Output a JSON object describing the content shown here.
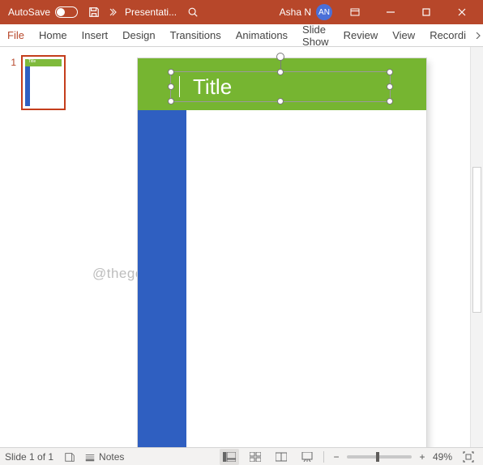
{
  "titlebar": {
    "autosave_label": "AutoSave",
    "autosave_state": "Off",
    "save_icon": "save-icon",
    "doc_title": "Presentati...",
    "user_name": "Asha N",
    "user_initials": "AN"
  },
  "ribbon": {
    "tabs": [
      "File",
      "Home",
      "Insert",
      "Design",
      "Transitions",
      "Animations",
      "Slide Show",
      "Review",
      "View",
      "Recordi"
    ]
  },
  "thumbnails": {
    "items": [
      {
        "number": "1",
        "title": "Title"
      }
    ]
  },
  "slide": {
    "title_text": "Title"
  },
  "watermark": "@thegeekpage.com",
  "statusbar": {
    "slide_counter": "Slide 1 of 1",
    "notes_label": "Notes",
    "zoom_value": "49%"
  }
}
